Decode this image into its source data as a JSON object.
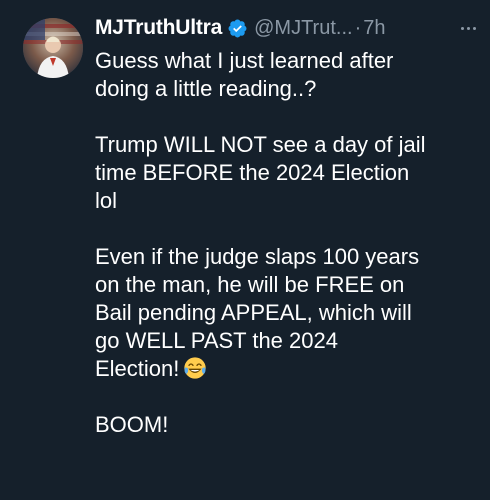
{
  "author": {
    "display_name": "MJTruthUltra",
    "handle": "@MJTrut...",
    "separator": "·",
    "time": "7h",
    "verified_color": "#1d9bf0"
  },
  "tweet": {
    "paragraphs": [
      [
        "Guess what I just learned after",
        "doing a little reading..?"
      ],
      [
        "Trump WILL NOT see a day of jail",
        "time BEFORE the 2024 Election",
        "lol"
      ],
      [
        "Even if the judge slaps 100 years",
        "on the man, he will be FREE on",
        "Bail pending APPEAL, which will",
        "go WELL PAST the 2024",
        "Election!"
      ],
      [
        "BOOM!"
      ]
    ],
    "emoji": "face-with-tears-of-joy"
  },
  "icons": {
    "more": "more-icon",
    "verified": "verified-badge-icon"
  },
  "colors": {
    "background": "#15202b",
    "text": "#ffffff",
    "secondary_text": "#8b98a5"
  }
}
